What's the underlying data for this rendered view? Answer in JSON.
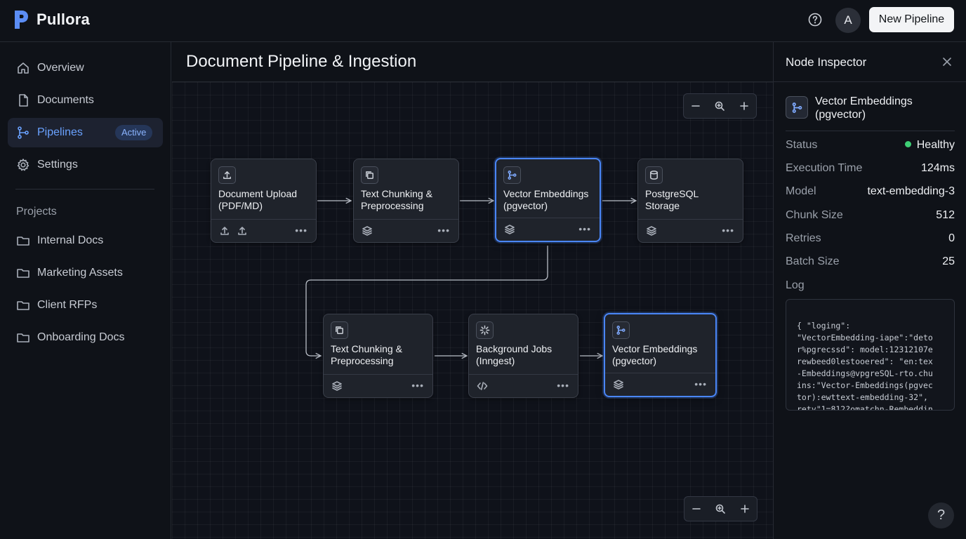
{
  "app": {
    "name": "Pullora",
    "accent": "#4a86f7"
  },
  "topbar": {
    "help_icon": "help-circle-icon",
    "avatar_initial": "A",
    "new_pipeline_label": "New Pipeline"
  },
  "sidebar": {
    "items": [
      {
        "label": "Overview",
        "icon": "home-icon"
      },
      {
        "label": "Documents",
        "icon": "file-icon"
      },
      {
        "label": "Pipelines",
        "icon": "git-branch-icon",
        "badge": "Active",
        "active": true
      },
      {
        "label": "Settings",
        "icon": "gear-icon"
      }
    ],
    "projects_title": "Projects",
    "projects": [
      {
        "label": "Internal Docs",
        "icon": "folder-icon"
      },
      {
        "label": "Marketing Assets",
        "icon": "folder-icon"
      },
      {
        "label": "Client RFPs",
        "icon": "folder-icon"
      },
      {
        "label": "Onboarding Docs",
        "icon": "folder-icon"
      }
    ]
  },
  "main": {
    "title": "Document Pipeline & Ingestion",
    "nodes": [
      {
        "title": "Document Upload\n(PDF/MD)",
        "icon": "upload-icon",
        "footer_icons": [
          "upload-icon",
          "upload-icon"
        ]
      },
      {
        "title": "Text Chunking &\nPreprocessing",
        "icon": "copy-icon",
        "footer_icons": [
          "layers-icon"
        ]
      },
      {
        "title": "Vector Embeddings\n(pgvector)",
        "icon": "git-branch-icon",
        "footer_icons": [
          "layers-icon"
        ],
        "selected": true
      },
      {
        "title": "PostgreSQL\nStorage",
        "icon": "database-icon",
        "footer_icons": [
          "layers-icon"
        ]
      },
      {
        "title": "Text Chunking &\nPreprocessing",
        "icon": "copy-icon",
        "footer_icons": [
          "layers-icon"
        ]
      },
      {
        "title": "Background Jobs\n(Inngest)",
        "icon": "sparkle-icon",
        "footer_icons": [
          "code-icon"
        ]
      },
      {
        "title": "Vector Embeddings\n(pgvector)",
        "icon": "git-branch-icon",
        "footer_icons": [
          "layers-icon"
        ],
        "selected": true
      }
    ],
    "zoom_controls": [
      "zoom-out-icon",
      "zoom-reset-icon",
      "zoom-in-icon"
    ]
  },
  "inspector": {
    "title": "Node Inspector",
    "node_name": "Vector Embeddings\n(pgvector)",
    "status_label": "Status",
    "status_value": "Healthy",
    "status_color": "#3ecf75",
    "properties": [
      {
        "key": "Execution Time",
        "value": "124ms"
      },
      {
        "key": "Model",
        "value": "text-embedding-3"
      },
      {
        "key": "Chunk Size",
        "value": "512"
      },
      {
        "key": "Retries",
        "value": "0"
      },
      {
        "key": "Batch Size",
        "value": "25"
      }
    ],
    "log_label": "Log",
    "log_text": "{ \"loging\":\n\"VectorEmbedding-iape\":\"deto\nr%pgrecssd\": model:12312107e\nrewbeed0lestooered\": \"en:tex\n-Embeddings@vpgreSQL-rto.chu\nins:\"Vector-Embeddings(pgvec\ntor):ewttext-embedding-32\",\nrety\"1=812?omatchn-Rembeddin"
  },
  "help_fab": "?"
}
